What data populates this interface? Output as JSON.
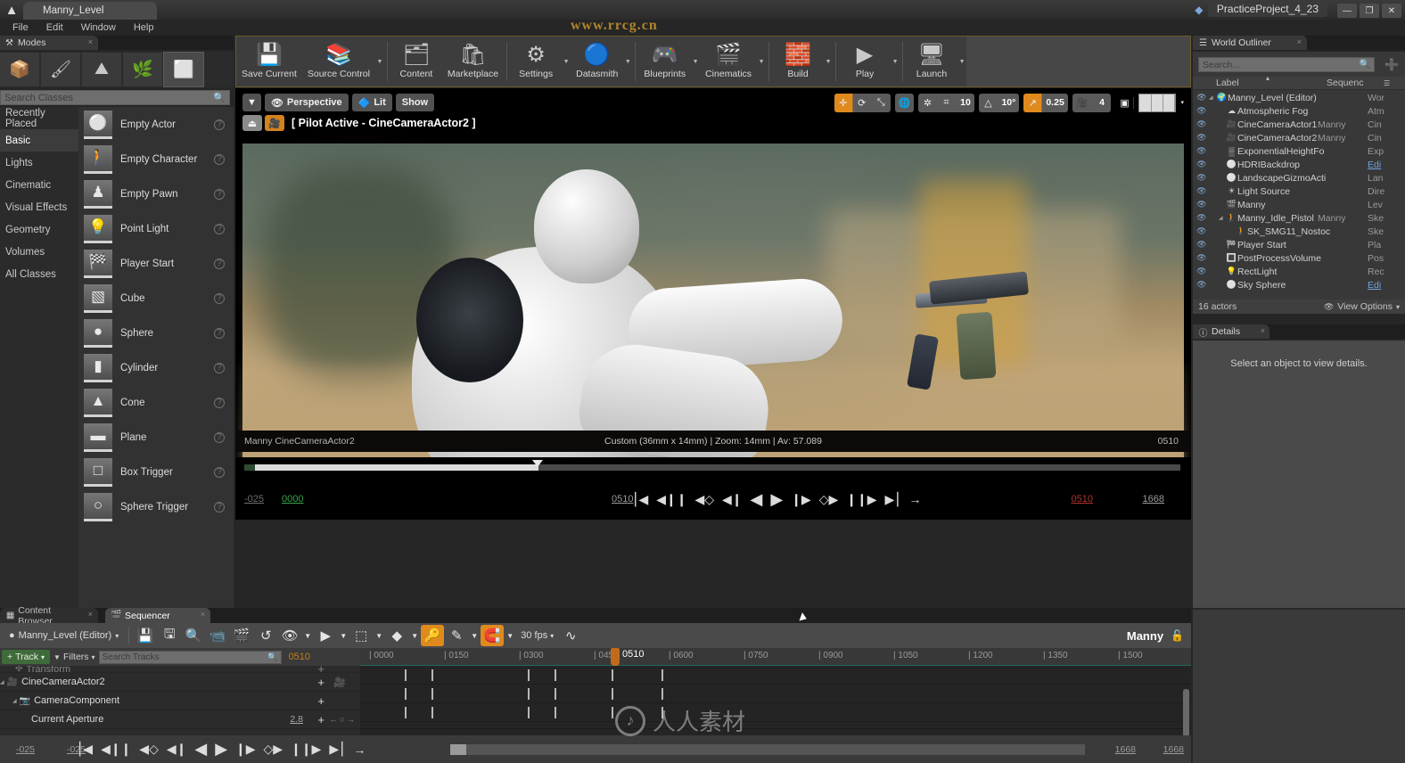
{
  "window": {
    "document_tab": "Manny_Level",
    "project_name": "PracticeProject_4_23",
    "minimize": "—",
    "maximize": "❐",
    "close": "✕",
    "watermark_top": "www.rrcg.cn"
  },
  "menu": {
    "items": [
      "File",
      "Edit",
      "Window",
      "Help"
    ]
  },
  "modes": {
    "tab_label": "Modes",
    "close": "×",
    "buttons": [
      {
        "name": "place-mode",
        "glyph": "📦",
        "selected": false
      },
      {
        "name": "paint-mode",
        "glyph": "🖌",
        "selected": false
      },
      {
        "name": "landscape-mode",
        "glyph": "⛰",
        "selected": false
      },
      {
        "name": "foliage-mode",
        "glyph": "🌿",
        "selected": false
      },
      {
        "name": "geometry-edit-mode",
        "glyph": "⬜",
        "selected": true
      }
    ],
    "search_placeholder": "Search Classes",
    "categories": [
      {
        "label": "Recently Placed",
        "selected": false
      },
      {
        "label": "Basic",
        "selected": true
      },
      {
        "label": "Lights",
        "selected": false
      },
      {
        "label": "Cinematic",
        "selected": false
      },
      {
        "label": "Visual Effects",
        "selected": false
      },
      {
        "label": "Geometry",
        "selected": false
      },
      {
        "label": "Volumes",
        "selected": false
      },
      {
        "label": "All Classes",
        "selected": false
      }
    ],
    "items": [
      {
        "label": "Empty Actor",
        "glyph": "⚪"
      },
      {
        "label": "Empty Character",
        "glyph": "🚶"
      },
      {
        "label": "Empty Pawn",
        "glyph": "♟"
      },
      {
        "label": "Point Light",
        "glyph": "💡"
      },
      {
        "label": "Player Start",
        "glyph": "🏁"
      },
      {
        "label": "Cube",
        "glyph": "▧"
      },
      {
        "label": "Sphere",
        "glyph": "●"
      },
      {
        "label": "Cylinder",
        "glyph": "▮"
      },
      {
        "label": "Cone",
        "glyph": "▲"
      },
      {
        "label": "Plane",
        "glyph": "▬"
      },
      {
        "label": "Box Trigger",
        "glyph": "□"
      },
      {
        "label": "Sphere Trigger",
        "glyph": "○"
      }
    ],
    "help_glyph": "?"
  },
  "toolbar": {
    "items": [
      {
        "label": "Save Current",
        "glyph": "💾",
        "caret": false
      },
      {
        "label": "Source Control",
        "glyph": "📚",
        "caret": true
      },
      {
        "label": "Content",
        "glyph": "🗂",
        "caret": false
      },
      {
        "label": "Marketplace",
        "glyph": "🛍",
        "caret": false
      },
      {
        "label": "Settings",
        "glyph": "⚙",
        "caret": true
      },
      {
        "label": "Datasmith",
        "glyph": "🔵",
        "caret": true
      },
      {
        "label": "Blueprints",
        "glyph": "🎮",
        "caret": true
      },
      {
        "label": "Cinematics",
        "glyph": "🎬",
        "caret": true
      },
      {
        "label": "Build",
        "glyph": "🧱",
        "caret": true
      },
      {
        "label": "Play",
        "glyph": "▶",
        "caret": true
      },
      {
        "label": "Launch",
        "glyph": "🖥",
        "caret": true
      }
    ]
  },
  "viewport": {
    "view_dropdown": "▼",
    "perspective_label": "Perspective",
    "lit_label": "Lit",
    "show_label": "Show",
    "pilot_text": "[ Pilot Active - CineCameraActor2 ]",
    "eject_glyph": "⏏",
    "pilot_glyph": "🎥",
    "transform_tools": [
      {
        "name": "select-move-tool",
        "glyph": "✛",
        "on": true
      },
      {
        "name": "rotate-tool",
        "glyph": "⟳",
        "on": false
      },
      {
        "name": "scale-tool",
        "glyph": "⤡",
        "on": false
      }
    ],
    "coord_system_glyph": "🌐",
    "surface_snap_glyph": "✲",
    "grid_snap_glyph": "⌗",
    "grid_snap_value": "10",
    "angle_snap_glyph": "△",
    "angle_snap_value": "10°",
    "scale_snap_glyph": "↗",
    "scale_snap_value": "0.25",
    "camera_speed_glyph": "🎥",
    "camera_speed_value": "4",
    "maximize_glyph": "▣",
    "layout_caret": "▾",
    "camera_actor_label": "Manny CineCameraActor2",
    "camera_info": "Custom (36mm x 14mm) | Zoom: 14mm | Av: 57.089",
    "camera_frame": "0510"
  },
  "transport": {
    "start_range": "-025",
    "start_frame": "0000",
    "current_frame": "0510",
    "end_frame": "0510",
    "end_range": "1668",
    "buttons": [
      {
        "name": "jump-to-start-button",
        "glyph": "⎮◀"
      },
      {
        "name": "step-back-frames-button",
        "glyph": "◀❙❙"
      },
      {
        "name": "previous-key-button",
        "glyph": "◀◇"
      },
      {
        "name": "step-back-button",
        "glyph": "◀❙"
      },
      {
        "name": "play-reverse-button",
        "glyph": "◀"
      },
      {
        "name": "play-forward-button",
        "glyph": "▶"
      },
      {
        "name": "step-forward-button",
        "glyph": "❙▶"
      },
      {
        "name": "next-key-button",
        "glyph": "◇▶"
      },
      {
        "name": "step-forward-frames-button",
        "glyph": "❙❙▶"
      },
      {
        "name": "jump-to-end-button",
        "glyph": "▶⎮"
      },
      {
        "name": "loop-button",
        "glyph": "→"
      }
    ]
  },
  "outliner": {
    "tab_label": "World Outliner",
    "close": "×",
    "search_placeholder": "Search...",
    "add_glyph": "➕",
    "columns": [
      "Label",
      "Sequenc"
    ],
    "sort_glyph": "▴",
    "rows": [
      {
        "label": "Manny_Level (Editor)",
        "col2": "",
        "col3": "Wor",
        "indent": 0,
        "expandable": true,
        "icon": "🌍",
        "link": false
      },
      {
        "label": "Atmospheric Fog",
        "col2": "",
        "col3": "Atm",
        "indent": 1,
        "expandable": false,
        "icon": "☁",
        "link": false
      },
      {
        "label": "CineCameraActor1",
        "col2": "Manny",
        "col3": "Cin",
        "indent": 1,
        "expandable": false,
        "icon": "🎥",
        "link": false
      },
      {
        "label": "CineCameraActor2",
        "col2": "Manny",
        "col3": "Cin",
        "indent": 1,
        "expandable": false,
        "icon": "🎥",
        "link": false
      },
      {
        "label": "ExponentialHeightFo",
        "col2": "",
        "col3": "Exp",
        "indent": 1,
        "expandable": false,
        "icon": "▒",
        "link": false
      },
      {
        "label": "HDRIBackdrop",
        "col2": "",
        "col3": "Edi",
        "indent": 1,
        "expandable": false,
        "icon": "⚪",
        "link": true
      },
      {
        "label": "LandscapeGizmoActi",
        "col2": "",
        "col3": "Lan",
        "indent": 1,
        "expandable": false,
        "icon": "⚪",
        "link": false
      },
      {
        "label": "Light Source",
        "col2": "",
        "col3": "Dire",
        "indent": 1,
        "expandable": false,
        "icon": "☀",
        "link": false
      },
      {
        "label": "Manny",
        "col2": "",
        "col3": "Lev",
        "indent": 1,
        "expandable": false,
        "icon": "🎬",
        "link": false
      },
      {
        "label": "Manny_Idle_Pistol",
        "col2": "Manny",
        "col3": "Ske",
        "indent": 1,
        "expandable": true,
        "icon": "🚶",
        "link": false
      },
      {
        "label": "SK_SMG11_Nostoc",
        "col2": "",
        "col3": "Ske",
        "indent": 2,
        "expandable": false,
        "icon": "🚶",
        "link": false
      },
      {
        "label": "Player Start",
        "col2": "",
        "col3": "Pla",
        "indent": 1,
        "expandable": false,
        "icon": "🏁",
        "link": false
      },
      {
        "label": "PostProcessVolume",
        "col2": "",
        "col3": "Pos",
        "indent": 1,
        "expandable": false,
        "icon": "🔳",
        "link": false
      },
      {
        "label": "RectLight",
        "col2": "",
        "col3": "Rec",
        "indent": 1,
        "expandable": false,
        "icon": "💡",
        "link": false
      },
      {
        "label": "Sky Sphere",
        "col2": "",
        "col3": "Edi",
        "indent": 1,
        "expandable": false,
        "icon": "⚪",
        "link": true
      }
    ],
    "actor_count": "16 actors",
    "view_options": "View Options",
    "eye_glyph": "👁",
    "view_options_caret": "▾"
  },
  "details": {
    "tab_label": "Details",
    "close": "×",
    "empty_message": "Select an object to view details."
  },
  "bottom_tabs": [
    {
      "label": "Content Browser",
      "selected": false,
      "glyph": "▦"
    },
    {
      "label": "Sequencer",
      "selected": true,
      "glyph": "🎬"
    }
  ],
  "sequencer": {
    "level_label": "Manny_Level (Editor)",
    "level_caret": "▾",
    "tools": [
      {
        "name": "save-sequence-button",
        "glyph": "💾",
        "on": false
      },
      {
        "name": "save-as-button",
        "glyph": "🖫",
        "on": false
      },
      {
        "name": "find-sequence-button",
        "glyph": "🔍",
        "on": false
      },
      {
        "name": "create-camera-button",
        "glyph": "📹",
        "on": false
      },
      {
        "name": "render-movie-button",
        "glyph": "🎬",
        "on": false
      },
      {
        "name": "undo-button",
        "glyph": "↺",
        "on": false
      },
      {
        "name": "actions-button",
        "glyph": "👁",
        "on": false,
        "caret": true
      },
      {
        "name": "playback-options-button",
        "glyph": "▶",
        "on": false,
        "caret": true
      },
      {
        "name": "selection-range-button",
        "glyph": "⬚",
        "on": false,
        "caret": true
      },
      {
        "name": "key-interpolation-button",
        "glyph": "◆",
        "on": false,
        "caret": true
      },
      {
        "name": "auto-key-button",
        "glyph": "🔑",
        "on": true
      },
      {
        "name": "curve-edit-button",
        "glyph": "✎",
        "on": false,
        "caret": true
      },
      {
        "name": "snapping-button",
        "glyph": "🧲",
        "on": true,
        "caret": true
      }
    ],
    "fps_label": "30 fps",
    "fps_caret": "▾",
    "curve_editor_glyph": "∿",
    "manny_label": "Manny",
    "lock_glyph": "🔓",
    "add_track_label": "Track",
    "add_track_plus": "+",
    "add_track_caret": "▾",
    "filters_label": "Filters",
    "filters_glyph": "▼",
    "filters_caret": "▾",
    "search_placeholder": "Search Tracks",
    "current_frame": "0510",
    "ruler_ticks": [
      "0000",
      "0150",
      "0300",
      "0450",
      "0600",
      "0750",
      "0900",
      "1050",
      "1200",
      "1350",
      "1500"
    ],
    "playhead_label": "0510",
    "tracks": [
      {
        "label": "Transform",
        "indent": 1,
        "value": "",
        "expandable": false,
        "icon": "✣",
        "partial": true
      },
      {
        "label": "CineCameraActor2",
        "indent": 0,
        "value": "",
        "expandable": true,
        "icon": "🎥",
        "camera": true
      },
      {
        "label": "CameraComponent",
        "indent": 1,
        "value": "",
        "expandable": true,
        "icon": "📷",
        "camera": false
      },
      {
        "label": "Current Aperture",
        "indent": 2,
        "value": "2.8",
        "expandable": false,
        "icon": "",
        "camera": false,
        "nav": true
      }
    ],
    "bottom": {
      "left_start": "-025",
      "left_current": "-025",
      "right_end": "1668",
      "right_total": "1668"
    }
  }
}
